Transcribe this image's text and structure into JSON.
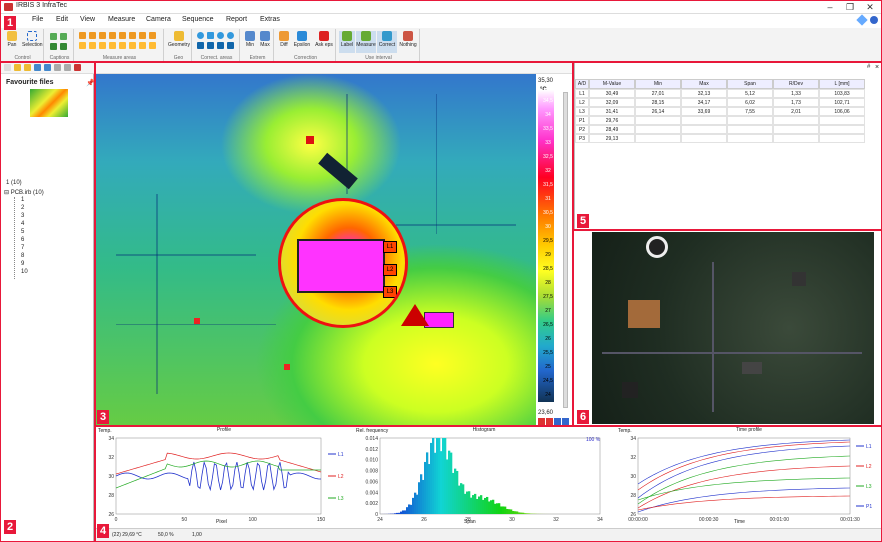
{
  "window": {
    "title": "IRBIS 3 InfraTec"
  },
  "menu": [
    "File",
    "Edit",
    "View",
    "Measure",
    "Camera",
    "Sequence",
    "Report",
    "Extras"
  ],
  "ribbon": {
    "pan": "Pan",
    "selection": "Selection",
    "geometry": "Geometry",
    "max": "Max",
    "min": "Min",
    "diff": "Diff",
    "epsilon": "Epsilon",
    "ask_eps": "Ask eps",
    "label": "Label",
    "measure": "Measure",
    "correct": "Correct",
    "nothing": "Nothing",
    "groups": [
      "Control",
      "Captions",
      "Measure areas",
      "Geo",
      "Correct. areas",
      "Extrem",
      "Correction",
      "Use interval"
    ]
  },
  "left_panel": {
    "favourites_title": "Favourite files",
    "file_count": "1 (10)",
    "tree_root": "PCB.irb (10)",
    "tree_items": [
      "1",
      "2",
      "3",
      "4",
      "5",
      "6",
      "7",
      "8",
      "9",
      "10"
    ]
  },
  "thermo": {
    "unit": "°C",
    "scale_max": "35,30",
    "scale_min": "23,60",
    "ticks": [
      "34,5",
      "34",
      "33,5",
      "33",
      "32,5",
      "32",
      "31,5",
      "31",
      "30,5",
      "30",
      "29,5",
      "29",
      "28,5",
      "28",
      "27,5",
      "27",
      "26,5",
      "26",
      "25,5",
      "25",
      "24,5",
      "24"
    ],
    "zoom_labels": [
      "L1",
      "L2",
      "L3"
    ]
  },
  "table": {
    "headers": [
      "A/D",
      "M-Value",
      "Min",
      "Max",
      "Span",
      "R/Dev",
      "L [mm]"
    ],
    "rows": [
      [
        "L1",
        "30,49",
        "27,01",
        "32,13",
        "5,12",
        "1,33",
        "103,83"
      ],
      [
        "L2",
        "32,09",
        "28,15",
        "34,17",
        "6,02",
        "1,73",
        "102,71"
      ],
      [
        "L3",
        "31,41",
        "26,14",
        "33,69",
        "7,55",
        "2,01",
        "106,06"
      ],
      [
        "P1",
        "29,76",
        "",
        "",
        "",
        "",
        ""
      ],
      [
        "P2",
        "28,49",
        "",
        "",
        "",
        "",
        ""
      ],
      [
        "P3",
        "29,13",
        "",
        "",
        "",
        "",
        ""
      ]
    ]
  },
  "plots": {
    "profile": {
      "title": "Profile",
      "ylabel": "Temp.",
      "xlabel": "Pixel",
      "yticks": [
        "34",
        "32",
        "30",
        "28",
        "26"
      ],
      "xticks": [
        "0",
        "50",
        "100",
        "150"
      ],
      "legend": [
        "L1",
        "L2",
        "L3"
      ]
    },
    "histogram": {
      "title": "Histogram",
      "ylabel": "Rel. frequency",
      "xlabel": "Span",
      "yticks": [
        "0.014",
        "0.012",
        "0.010",
        "0.008",
        "0.006",
        "0.004",
        "0.002",
        "0"
      ],
      "xticks": [
        "24",
        "26",
        "28",
        "30",
        "32",
        "34"
      ],
      "pct": "100 %"
    },
    "time": {
      "title": "Time profile",
      "ylabel": "Temp.",
      "xlabel": "Time",
      "yticks": [
        "34",
        "32",
        "30",
        "28",
        "26"
      ],
      "xticks": [
        "00:00:00",
        "00:00:30",
        "00:01:00",
        "00:01:30"
      ],
      "legend": [
        "L1",
        "L2",
        "L3",
        "P1"
      ]
    }
  },
  "status": {
    "coord": "(22) 29,69 °C",
    "zoom": "50,0 %",
    "factor": "1,00"
  },
  "callouts": [
    "1",
    "2",
    "3",
    "4",
    "5",
    "6"
  ],
  "colors": {
    "callout": "#e8183a",
    "l1": "#2233cc",
    "l2": "#e02020",
    "l3": "#22aa22"
  }
}
